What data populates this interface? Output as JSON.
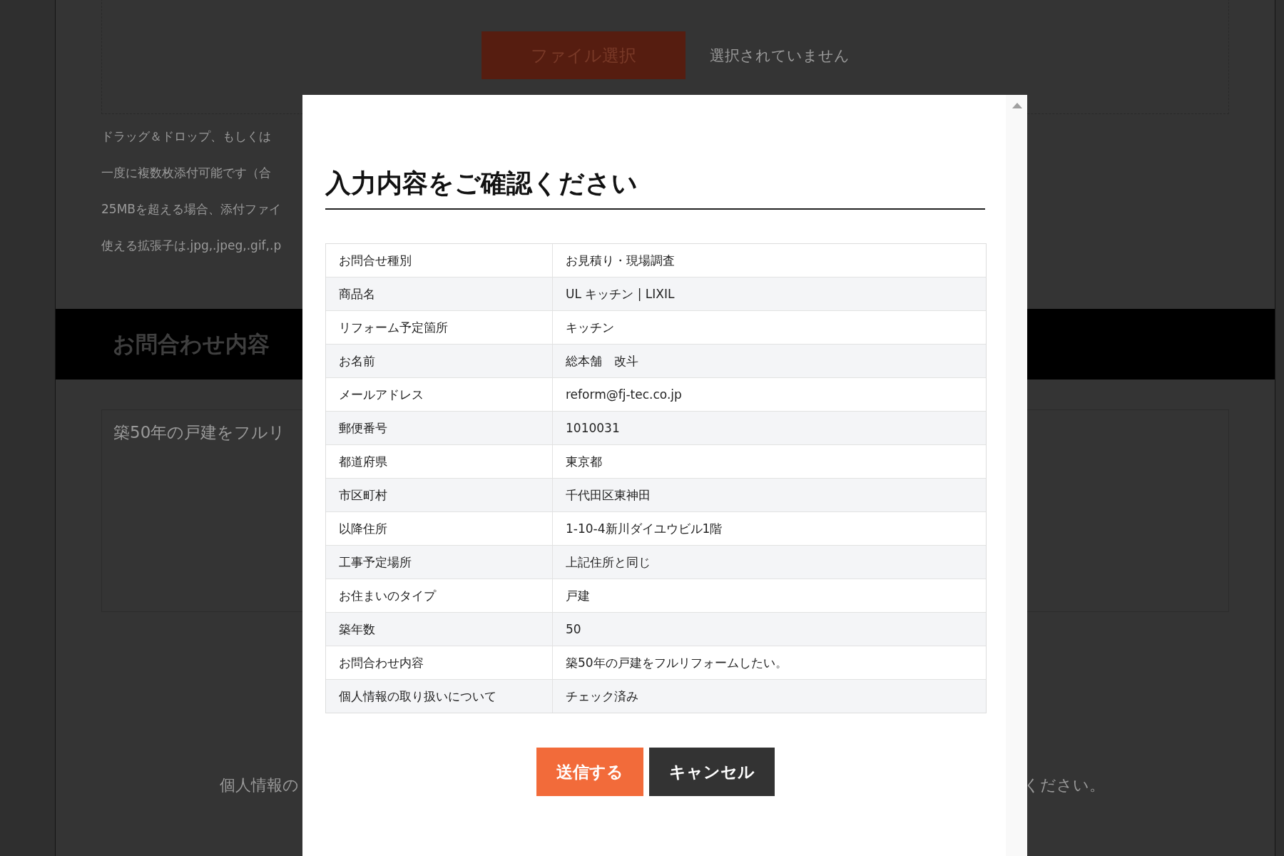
{
  "page": {
    "file_button": "ファイル選択",
    "file_status": "選択されていません",
    "notes": [
      "ドラッグ＆ドロップ、もしくは",
      "一度に複数枚添付可能です（合",
      "25MBを超える場合、添付ファイ",
      "使える拡張子は.jpg,.jpeg,.gif,.p"
    ],
    "section_title": "お問合わせ内容",
    "message_value": "築50年の戸建をフルリ",
    "privacy_note_start": "個人情報の",
    "privacy_note_end": "ください。"
  },
  "modal": {
    "title": "入力内容をご確認ください",
    "rows": [
      {
        "label": "お問合せ種別",
        "value": "お見積り・現場調査"
      },
      {
        "label": "商品名",
        "value": "UL キッチン | LIXIL"
      },
      {
        "label": "リフォーム予定箇所",
        "value": "キッチン"
      },
      {
        "label": "お名前",
        "value": "総本舗　改斗"
      },
      {
        "label": "メールアドレス",
        "value": "reform@fj-tec.co.jp"
      },
      {
        "label": "郵便番号",
        "value": "1010031"
      },
      {
        "label": "都道府県",
        "value": "東京都"
      },
      {
        "label": "市区町村",
        "value": "千代田区東神田"
      },
      {
        "label": "以降住所",
        "value": "1-10-4新川ダイユウビル1階"
      },
      {
        "label": "工事予定場所",
        "value": "上記住所と同じ"
      },
      {
        "label": "お住まいのタイプ",
        "value": "戸建"
      },
      {
        "label": "築年数",
        "value": "50"
      },
      {
        "label": "お問合わせ内容",
        "value": "築50年の戸建をフルリフォームしたい。"
      },
      {
        "label": "個人情報の取り扱いについて",
        "value": "チェック済み"
      }
    ],
    "buttons": [
      {
        "label": "送信する",
        "kind": "submit"
      },
      {
        "label": "キャンセル",
        "kind": "cancel"
      }
    ]
  }
}
